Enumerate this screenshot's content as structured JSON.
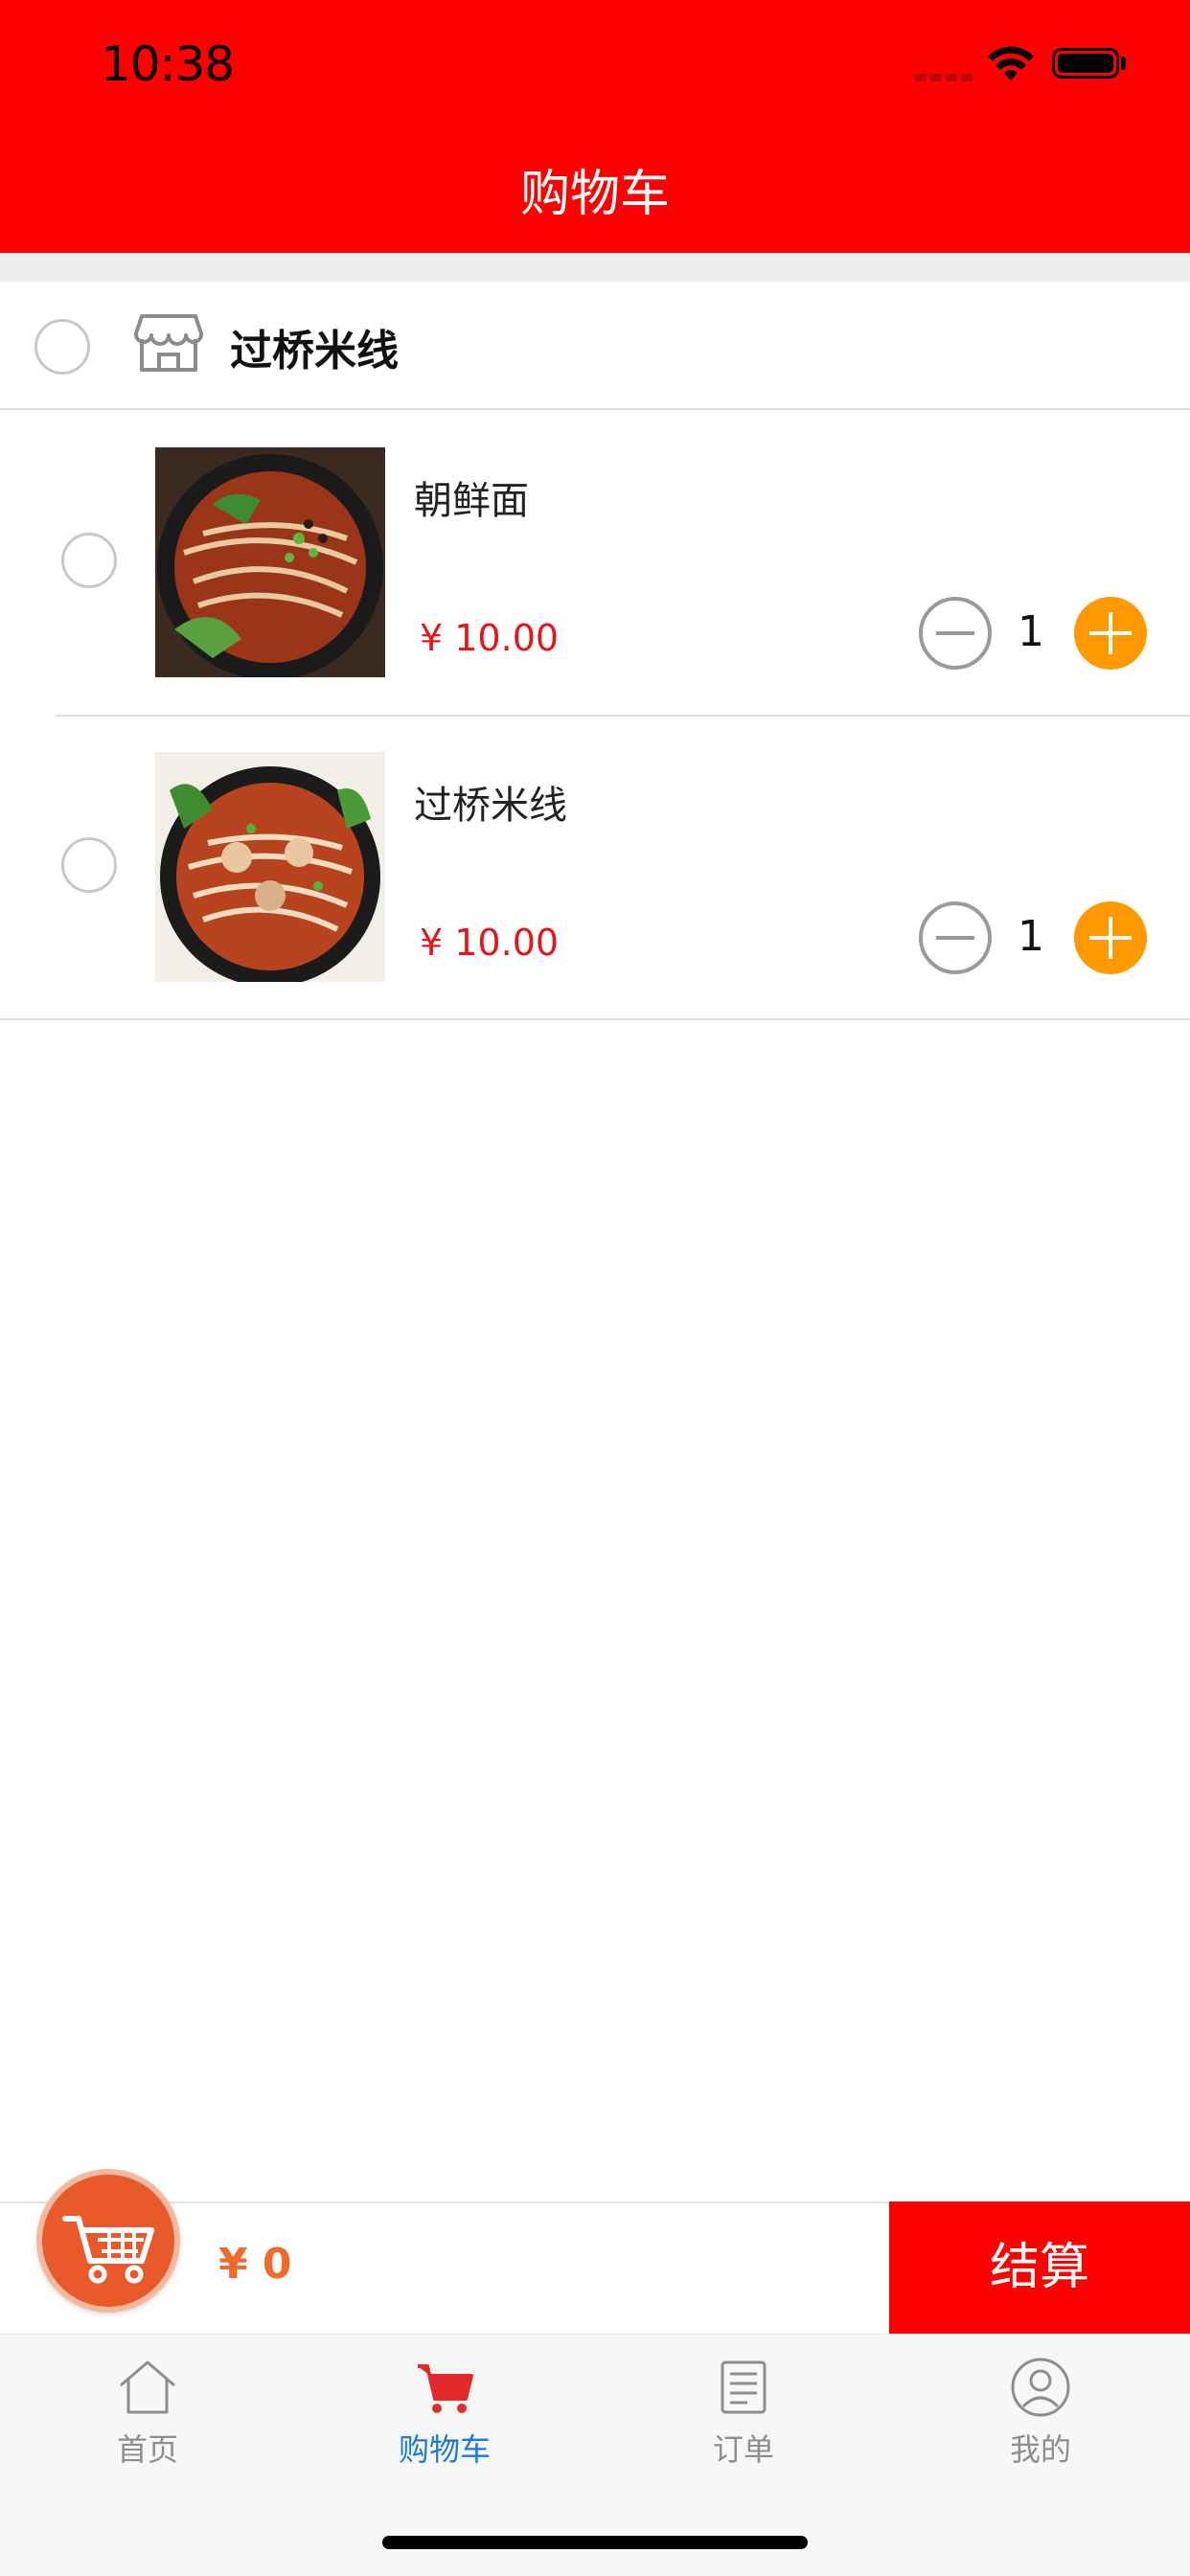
{
  "status_bar": {
    "time": "10:38"
  },
  "header": {
    "title": "购物车"
  },
  "shop": {
    "name": "过桥米线"
  },
  "items": [
    {
      "name": "朝鲜面",
      "price": "¥ 10.00",
      "quantity": "1"
    },
    {
      "name": "过桥米线",
      "price": "¥ 10.00",
      "quantity": "1"
    }
  ],
  "cart_bar": {
    "total": "¥ 0",
    "checkout_label": "结算"
  },
  "tabs": [
    {
      "label": "首页",
      "icon": "home-icon"
    },
    {
      "label": "购物车",
      "icon": "cart-icon",
      "active": true
    },
    {
      "label": "订单",
      "icon": "order-list-icon"
    },
    {
      "label": "我的",
      "icon": "profile-icon"
    }
  ],
  "colors": {
    "brand": "#ff0000",
    "accent": "#ff9900",
    "price": "#e8141b",
    "tab_active": "#1a7bd6"
  }
}
